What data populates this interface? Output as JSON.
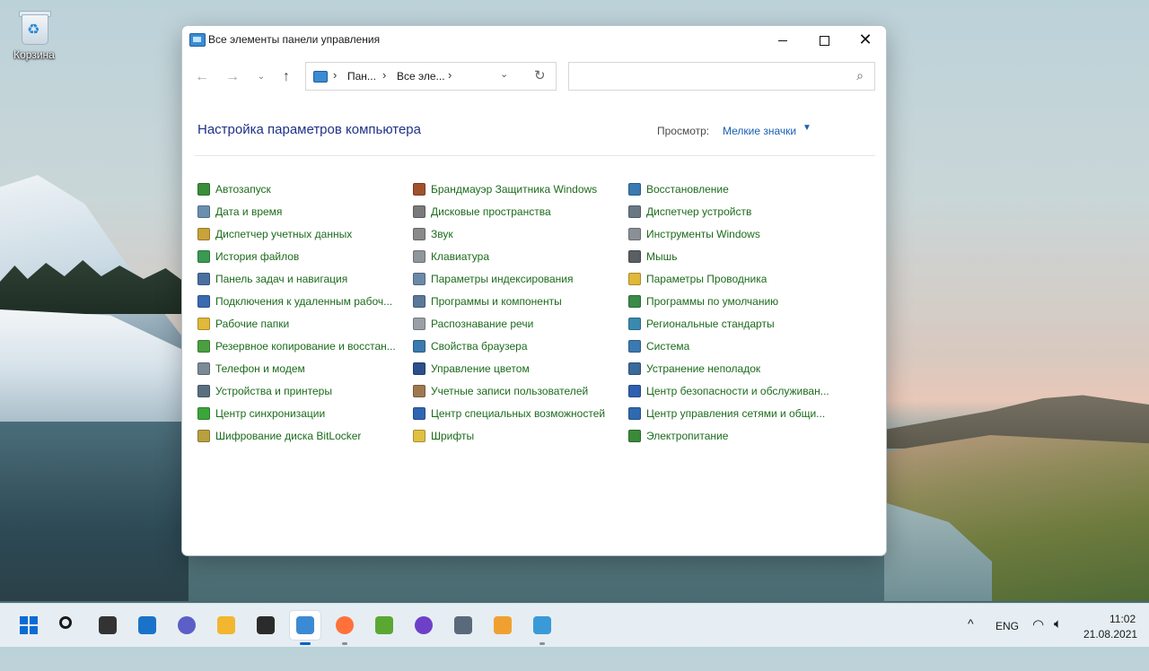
{
  "desktop": {
    "recycle_bin_label": "Корзина"
  },
  "window": {
    "title": "Все элементы панели управления",
    "icon": "control-panel-icon"
  },
  "nav": {
    "back_icon": "arrow-left-icon",
    "forward_icon": "arrow-right-icon",
    "recent_icon": "chevron-down-icon",
    "up_icon": "arrow-up-icon",
    "breadcrumb": [
      "Пан...",
      "Все эле..."
    ],
    "search_placeholder": ""
  },
  "header": {
    "title": "Настройка параметров компьютера",
    "view_label": "Просмотр:",
    "view_value": "Мелкие значки"
  },
  "items": {
    "col0": [
      {
        "label": "Автозапуск",
        "icon": "autoplay-icon",
        "color": "#3a8f3a"
      },
      {
        "label": "Дата и время",
        "icon": "clock-icon",
        "color": "#6a8fb0"
      },
      {
        "label": "Диспетчер учетных данных",
        "icon": "credential-icon",
        "color": "#c8a23a"
      },
      {
        "label": "История файлов",
        "icon": "file-history-icon",
        "color": "#3a9a52"
      },
      {
        "label": "Панель задач и навигация",
        "icon": "taskbar-icon",
        "color": "#4a6fa0"
      },
      {
        "label": "Подключения к удаленным рабоч...",
        "icon": "remote-desktop-icon",
        "color": "#3a6ab0"
      },
      {
        "label": "Рабочие папки",
        "icon": "work-folders-icon",
        "color": "#e0b83a"
      },
      {
        "label": "Резервное копирование и восстан...",
        "icon": "backup-icon",
        "color": "#4aa040"
      },
      {
        "label": "Телефон и модем",
        "icon": "phone-modem-icon",
        "color": "#7a8a96"
      },
      {
        "label": "Устройства и принтеры",
        "icon": "printer-icon",
        "color": "#5a6f80"
      },
      {
        "label": "Центр синхронизации",
        "icon": "sync-icon",
        "color": "#3aa63a"
      },
      {
        "label": "Шифрование диска BitLocker",
        "icon": "bitlocker-icon",
        "color": "#b8a040"
      }
    ],
    "col1": [
      {
        "label": "Брандмауэр Защитника Windows",
        "icon": "firewall-icon",
        "color": "#a0522d"
      },
      {
        "label": "Дисковые пространства",
        "icon": "storage-spaces-icon",
        "color": "#7a7a7a"
      },
      {
        "label": "Звук",
        "icon": "speaker-icon",
        "color": "#8a8a8a"
      },
      {
        "label": "Клавиатура",
        "icon": "keyboard-icon",
        "color": "#8f969c"
      },
      {
        "label": "Параметры индексирования",
        "icon": "indexing-icon",
        "color": "#6a8aa8"
      },
      {
        "label": "Программы и компоненты",
        "icon": "programs-icon",
        "color": "#5a7898"
      },
      {
        "label": "Распознавание речи",
        "icon": "microphone-icon",
        "color": "#9aa0a6"
      },
      {
        "label": "Свойства браузера",
        "icon": "internet-options-icon",
        "color": "#3a7ab0"
      },
      {
        "label": "Управление цветом",
        "icon": "color-management-icon",
        "color": "#2c4f8a"
      },
      {
        "label": "Учетные записи пользователей",
        "icon": "users-icon",
        "color": "#a07850"
      },
      {
        "label": "Центр специальных возможностей",
        "icon": "ease-of-access-icon",
        "color": "#2f66b3"
      },
      {
        "label": "Шрифты",
        "icon": "fonts-icon",
        "color": "#e0c040"
      }
    ],
    "col2": [
      {
        "label": "Восстановление",
        "icon": "recovery-icon",
        "color": "#3a7ab0"
      },
      {
        "label": "Диспетчер устройств",
        "icon": "device-manager-icon",
        "color": "#6a7884"
      },
      {
        "label": "Инструменты Windows",
        "icon": "windows-tools-icon",
        "color": "#8a9096"
      },
      {
        "label": "Мышь",
        "icon": "mouse-icon",
        "color": "#5a5f64"
      },
      {
        "label": "Параметры Проводника",
        "icon": "folder-options-icon",
        "color": "#e0b83a"
      },
      {
        "label": "Программы по умолчанию",
        "icon": "default-programs-icon",
        "color": "#3a8a4a"
      },
      {
        "label": "Региональные стандарты",
        "icon": "region-icon",
        "color": "#3a8ab0"
      },
      {
        "label": "Система",
        "icon": "system-icon",
        "color": "#3a7ab0"
      },
      {
        "label": "Устранение неполадок",
        "icon": "troubleshoot-icon",
        "color": "#3a6a9a"
      },
      {
        "label": "Центр безопасности и обслуживан...",
        "icon": "security-flag-icon",
        "color": "#2f5fb0"
      },
      {
        "label": "Центр управления сетями и общи...",
        "icon": "network-icon",
        "color": "#2f6ab0"
      },
      {
        "label": "Электропитание",
        "icon": "power-icon",
        "color": "#3a8a3a"
      }
    ]
  },
  "taskbar": {
    "apps": [
      {
        "name": "start",
        "icon": "windows-logo-icon",
        "color": "#0b6cd4",
        "active": false,
        "running": false
      },
      {
        "name": "search",
        "icon": "search-icon",
        "color": "#1a1a1a",
        "active": false,
        "running": false
      },
      {
        "name": "task-view",
        "icon": "task-view-icon",
        "color": "#333333",
        "active": false,
        "running": false
      },
      {
        "name": "widgets",
        "icon": "widgets-icon",
        "color": "#1a73c9",
        "active": false,
        "running": false
      },
      {
        "name": "chat",
        "icon": "chat-icon",
        "color": "#5b5fc7",
        "active": false,
        "running": false
      },
      {
        "name": "file-explorer",
        "icon": "folder-icon",
        "color": "#f2b631",
        "active": false,
        "running": false
      },
      {
        "name": "store",
        "icon": "store-icon",
        "color": "#2b2b2b",
        "active": false,
        "running": false
      },
      {
        "name": "control-panel",
        "icon": "control-panel-icon",
        "color": "#3b8bd4",
        "active": true,
        "running": true
      },
      {
        "name": "firefox",
        "icon": "firefox-icon",
        "color": "#ff7139",
        "active": false,
        "running": true
      },
      {
        "name": "app-green",
        "icon": "image-editor-icon",
        "color": "#5aa832",
        "active": false,
        "running": false
      },
      {
        "name": "github",
        "icon": "github-icon",
        "color": "#6e40c9",
        "active": false,
        "running": false
      },
      {
        "name": "calculator",
        "icon": "calculator-icon",
        "color": "#5a6a7a",
        "active": false,
        "running": false
      },
      {
        "name": "media",
        "icon": "media-player-icon",
        "color": "#f0a030",
        "active": false,
        "running": false
      },
      {
        "name": "paint",
        "icon": "paint-icon",
        "color": "#3a9ad8",
        "active": false,
        "running": true
      }
    ],
    "tray": {
      "chevron_icon": "chevron-up-icon",
      "language": "ENG",
      "wifi_icon": "wifi-icon",
      "volume_icon": "volume-icon",
      "time": "11:02",
      "date": "21.08.2021"
    }
  }
}
